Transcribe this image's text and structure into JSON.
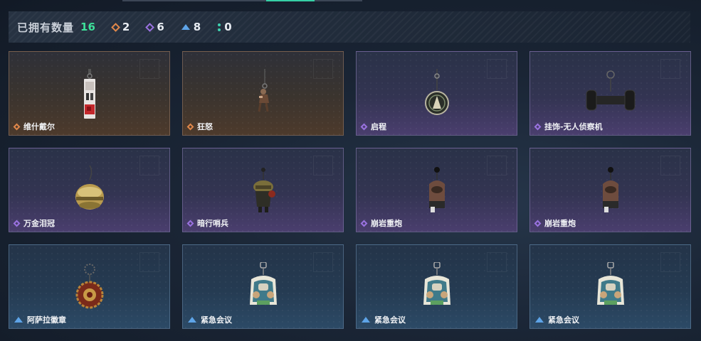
{
  "stats": {
    "label": "已拥有数量",
    "total": "16",
    "counts": [
      {
        "quality": "orange",
        "value": "2"
      },
      {
        "quality": "purple",
        "value": "6"
      },
      {
        "quality": "blue",
        "value": "8"
      },
      {
        "quality": "teal",
        "value": "0"
      }
    ]
  },
  "colors": {
    "orange": "#e0874a",
    "purple": "#9a72e0",
    "blue": "#5ea4e8",
    "teal": "#3ed2b0",
    "total": "#3ee09a"
  },
  "items": [
    {
      "name": "维什戴尔",
      "quality": "orange",
      "icon": "vishdeal-tag-charm-icon"
    },
    {
      "name": "狂怒",
      "quality": "orange",
      "icon": "rage-figure-charm-icon"
    },
    {
      "name": "启程",
      "quality": "purple",
      "icon": "round-badge-charm-icon"
    },
    {
      "name": "挂饰-无人侦察机",
      "quality": "purple",
      "icon": "drone-charm-icon"
    },
    {
      "name": "万金泪冠",
      "quality": "purple",
      "icon": "golden-crown-charm-icon"
    },
    {
      "name": "暗行哨兵",
      "quality": "purple",
      "icon": "sentinel-figure-charm-icon"
    },
    {
      "name": "崩岩重炮",
      "quality": "purple",
      "icon": "heavy-cannon-figure-charm-icon"
    },
    {
      "name": "崩岩重炮",
      "quality": "purple",
      "icon": "heavy-cannon-figure-charm-icon"
    },
    {
      "name": "阿萨拉徽章",
      "quality": "blue",
      "icon": "asala-medal-charm-icon"
    },
    {
      "name": "紧急会议",
      "quality": "blue",
      "icon": "emergency-meeting-charm-icon"
    },
    {
      "name": "紧急会议",
      "quality": "blue",
      "icon": "emergency-meeting-charm-icon"
    },
    {
      "name": "紧急会议",
      "quality": "blue",
      "icon": "emergency-meeting-charm-icon"
    }
  ]
}
